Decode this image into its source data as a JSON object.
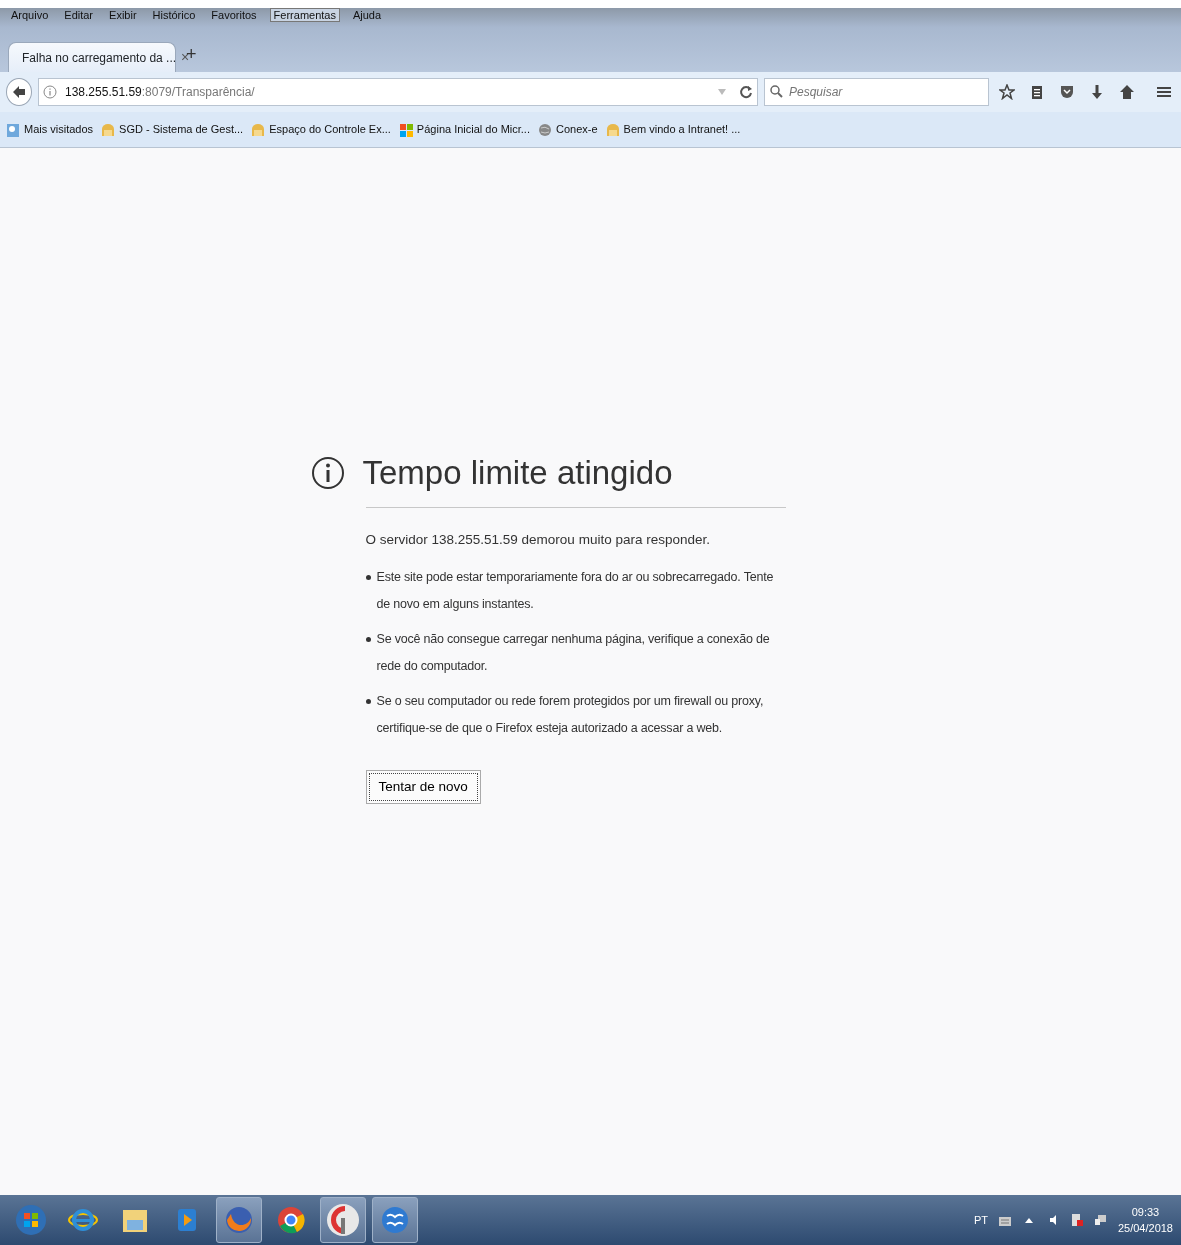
{
  "menu": [
    {
      "label": "Arquivo",
      "selected": false
    },
    {
      "label": "Editar",
      "selected": false
    },
    {
      "label": "Exibir",
      "selected": false
    },
    {
      "label": "Histórico",
      "selected": false
    },
    {
      "label": "Favoritos",
      "selected": false
    },
    {
      "label": "Ferramentas",
      "selected": true
    },
    {
      "label": "Ajuda",
      "selected": false
    }
  ],
  "tabs": [
    {
      "title": "Falha no carregamento da ...",
      "close": "×",
      "selected": true
    }
  ],
  "new_tab": "+",
  "address": {
    "host": "138.255.51.59",
    "rest": ":8079/Transparência/"
  },
  "search": {
    "placeholder": "Pesquisar"
  },
  "bookmarks": [
    {
      "label": "Mais visitados",
      "kind": "search"
    },
    {
      "label": "SGD - Sistema de Gest...",
      "kind": "folder"
    },
    {
      "label": "Espaço do Controle Ex...",
      "kind": "folder"
    },
    {
      "label": "Página Inicial do Micr...",
      "kind": "tiles"
    },
    {
      "label": "Conex-e",
      "kind": "globe"
    },
    {
      "label": "Bem vindo a Intranet! ...",
      "kind": "folder"
    }
  ],
  "error": {
    "title": "Tempo limite atingido",
    "message": "O servidor 138.255.51.59 demorou muito para responder.",
    "tips": [
      "Este site pode estar temporariamente fora do ar ou sobrecarregado. Tente de novo em alguns instantes.",
      "Se você não consegue carregar nenhuma página, verifique a conexão de rede do computador.",
      "Se o seu computador ou rede forem protegidos por um firewall ou proxy, certifique-se de que o Firefox esteja autorizado a acessar a web."
    ],
    "button": "Tentar de novo"
  },
  "taskbar": {
    "apps": [
      {
        "kind": "start",
        "running": false
      },
      {
        "kind": "ie",
        "running": false
      },
      {
        "kind": "explorer",
        "running": false
      },
      {
        "kind": "media",
        "running": false
      },
      {
        "kind": "firefox",
        "running": true
      },
      {
        "kind": "chrome",
        "running": false
      },
      {
        "kind": "tool",
        "running": true
      },
      {
        "kind": "office",
        "running": true
      }
    ],
    "language": "PT",
    "time": "09:33",
    "date": "25/04/2018"
  }
}
